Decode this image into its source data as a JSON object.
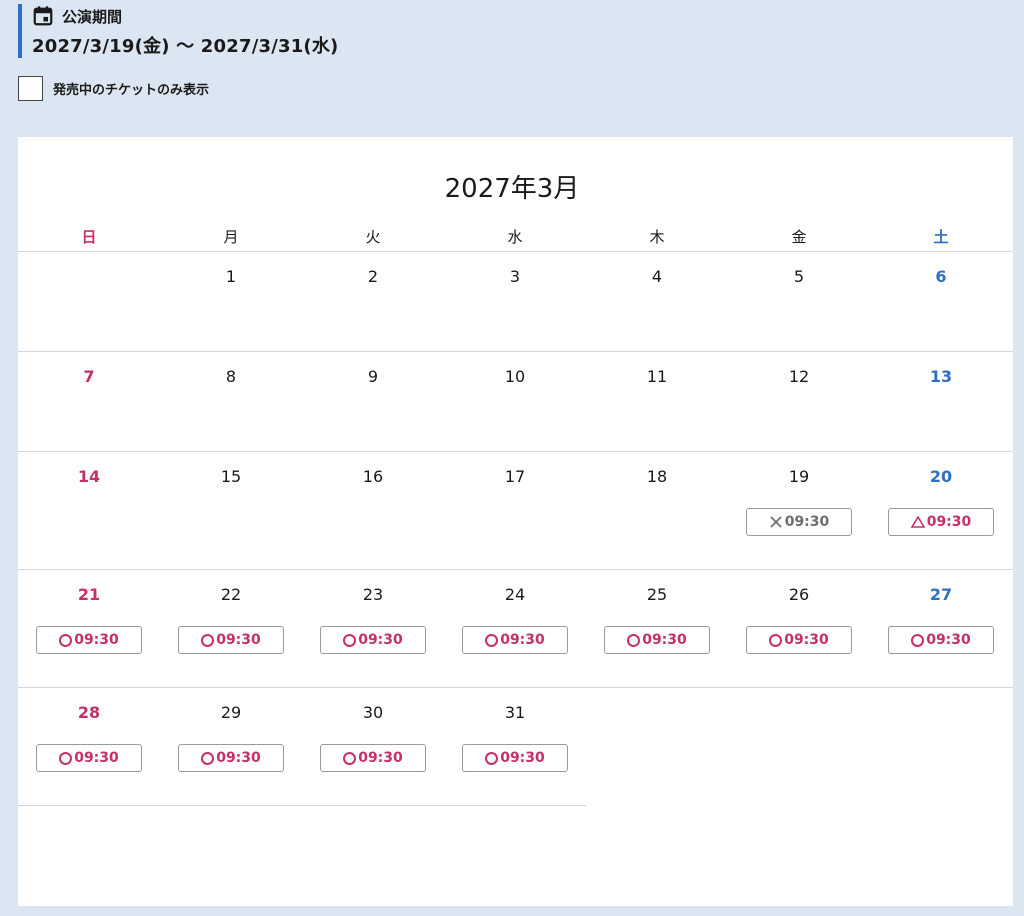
{
  "period": {
    "label": "公演期間",
    "value": "2027/3/19(金) 〜 2027/3/31(水)"
  },
  "filter": {
    "label": "発売中のチケットのみ表示",
    "checked": false
  },
  "calendar": {
    "month_title": "2027年3月",
    "weekdays": [
      "日",
      "月",
      "火",
      "水",
      "木",
      "金",
      "土"
    ],
    "days": [
      {
        "day": "1"
      },
      {
        "day": "2"
      },
      {
        "day": "3"
      },
      {
        "day": "4"
      },
      {
        "day": "5"
      },
      {
        "day": "6"
      },
      {
        "day": "7"
      },
      {
        "day": "8"
      },
      {
        "day": "9"
      },
      {
        "day": "10"
      },
      {
        "day": "11"
      },
      {
        "day": "12"
      },
      {
        "day": "13"
      },
      {
        "day": "14"
      },
      {
        "day": "15"
      },
      {
        "day": "16"
      },
      {
        "day": "17"
      },
      {
        "day": "18"
      },
      {
        "day": "19",
        "slot": {
          "status": "soldout",
          "time": "09:30"
        }
      },
      {
        "day": "20",
        "slot": {
          "status": "few",
          "time": "09:30"
        }
      },
      {
        "day": "21",
        "slot": {
          "status": "available",
          "time": "09:30"
        }
      },
      {
        "day": "22",
        "slot": {
          "status": "available",
          "time": "09:30"
        }
      },
      {
        "day": "23",
        "slot": {
          "status": "available",
          "time": "09:30"
        }
      },
      {
        "day": "24",
        "slot": {
          "status": "available",
          "time": "09:30"
        }
      },
      {
        "day": "25",
        "slot": {
          "status": "available",
          "time": "09:30"
        }
      },
      {
        "day": "26",
        "slot": {
          "status": "available",
          "time": "09:30"
        }
      },
      {
        "day": "27",
        "slot": {
          "status": "available",
          "time": "09:30"
        }
      },
      {
        "day": "28",
        "slot": {
          "status": "available",
          "time": "09:30"
        }
      },
      {
        "day": "29",
        "slot": {
          "status": "available",
          "time": "09:30"
        }
      },
      {
        "day": "30",
        "slot": {
          "status": "available",
          "time": "09:30"
        }
      },
      {
        "day": "31",
        "slot": {
          "status": "available",
          "time": "09:30"
        }
      }
    ],
    "first_weekday_index": 1
  },
  "colors": {
    "sunday": "#c6306a",
    "saturday": "#2f6fbf",
    "accent_bar": "#2f6fbf",
    "page_bg": "#dce6f2",
    "soldout": "#6e6e6e"
  },
  "icons": {
    "period": "calendar-icon",
    "available": "circle-mark-icon",
    "few": "triangle-mark-icon",
    "soldout": "cross-mark-icon"
  }
}
